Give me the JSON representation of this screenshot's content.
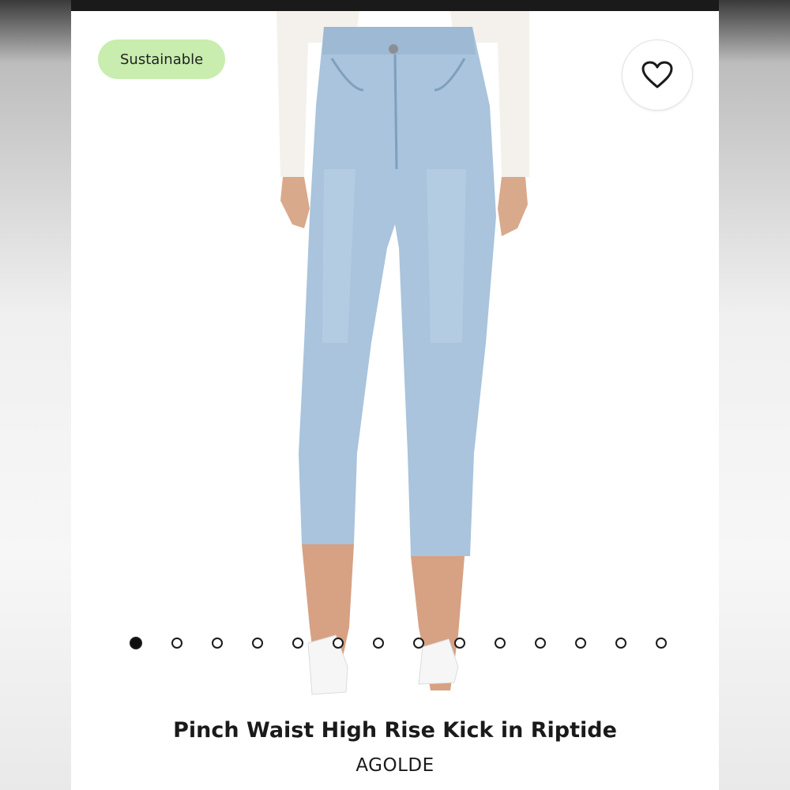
{
  "badge": {
    "label": "Sustainable",
    "color": "#c8edae"
  },
  "favorite": {
    "icon": "heart-outline-icon"
  },
  "product": {
    "title": "Pinch Waist High Rise Kick in Riptide",
    "brand": "AGOLDE",
    "denim_color": "#a9c4dc"
  },
  "carousel": {
    "count": 14,
    "active_index": 0
  }
}
